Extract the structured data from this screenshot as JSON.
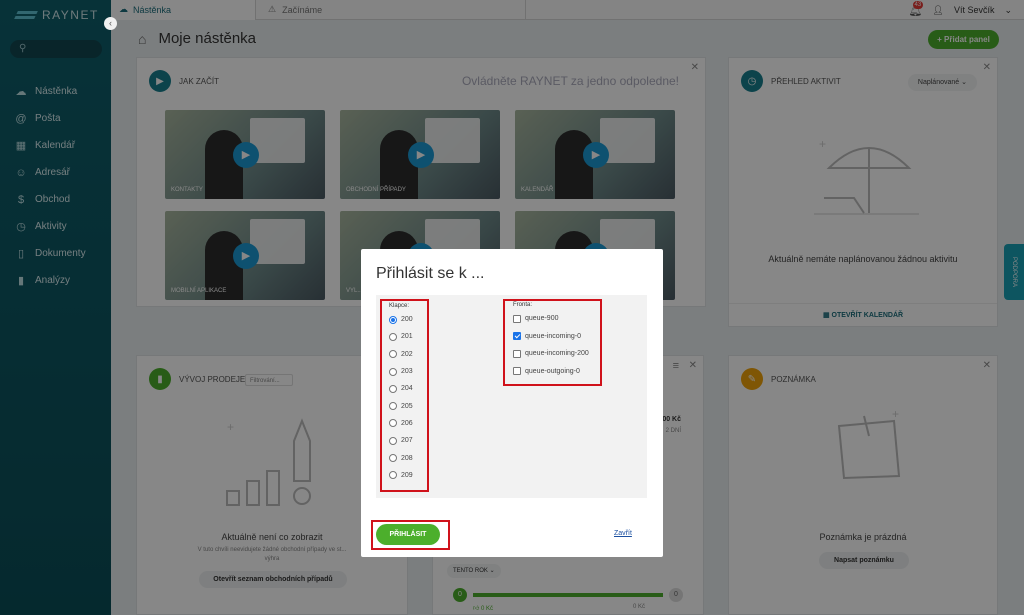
{
  "app": {
    "logo_text": "RAYNET"
  },
  "topbar": {
    "active_tab": "Nástěnka",
    "start_tab": "Začínáme",
    "notification_count": "43",
    "user_name": "Vít Sevčík"
  },
  "sidebar": {
    "items": [
      {
        "label": "Nástěnka",
        "icon": "cloud-icon",
        "glyph": "☁"
      },
      {
        "label": "Pošta",
        "icon": "at-icon",
        "glyph": "@"
      },
      {
        "label": "Kalendář",
        "icon": "calendar-icon",
        "glyph": "▦"
      },
      {
        "label": "Adresář",
        "icon": "contacts-icon",
        "glyph": "☺"
      },
      {
        "label": "Obchod",
        "icon": "dollar-icon",
        "glyph": "$"
      },
      {
        "label": "Aktivity",
        "icon": "clock-icon",
        "glyph": "◷"
      },
      {
        "label": "Dokumenty",
        "icon": "document-icon",
        "glyph": "▯"
      },
      {
        "label": "Analýzy",
        "icon": "chart-icon",
        "glyph": "▮"
      }
    ]
  },
  "page": {
    "title": "Moje nástěnka",
    "add_panel": "+ Přidat panel"
  },
  "start_panel": {
    "title": "JAK ZAČÍT",
    "tagline": "Ovládněte RAYNET za jedno odpoledne!",
    "videos": [
      "KONTAKTY",
      "OBCHODNÍ PŘÍPADY",
      "KALENDÁŘ",
      "MOBILNÍ APLIKACE",
      "VYL...",
      ""
    ]
  },
  "activity_panel": {
    "title": "PŘEHLED AKTIVIT",
    "dropdown": "Naplánované",
    "empty": "Aktuálně nemáte naplánovanou žádnou aktivitu",
    "open_calendar": "OTEVŘÍT KALENDÁŘ"
  },
  "support_tab": "PODPORA",
  "sales_panel": {
    "title": "VÝVOJ PRODEJE",
    "filter_placeholder": "Filtrování...",
    "empty": "Aktuálně není co zobrazit",
    "hint_1": "V tuto chvíli neevidujete žádné obchodní případy ve st...",
    "hint_2": "výhra",
    "button": "Otevřít seznam obchodních případů"
  },
  "mid_panel": {
    "amount": "00 Kč",
    "sub": "2 DNÍ",
    "period": "TENTO ROK",
    "progress_start": "0",
    "progress_end": "0",
    "progress_left": "0 Kč",
    "progress_right": "0 Kč"
  },
  "note_panel": {
    "title": "POZNÁMKA",
    "empty": "Poznámka je prázdná",
    "button": "Napsat poznámku"
  },
  "dialog": {
    "title": "Přihlásit se k ...",
    "lines_label": "Klapce:",
    "lines": [
      "200",
      "201",
      "202",
      "203",
      "204",
      "205",
      "206",
      "207",
      "208",
      "209"
    ],
    "selected_line": "200",
    "queues_label": "Fronta:",
    "queues": [
      {
        "name": "queue-900",
        "checked": false
      },
      {
        "name": "queue-incoming-0",
        "checked": true
      },
      {
        "name": "queue-incoming-200",
        "checked": false
      },
      {
        "name": "queue-outgoing-0",
        "checked": false
      }
    ],
    "login_button": "PŘIHLÁSIT",
    "close_link": "Zavřít"
  },
  "colors": {
    "brand": "#0f5f6b",
    "accent_green": "#4caf2c",
    "highlight_red": "#d0121b"
  }
}
